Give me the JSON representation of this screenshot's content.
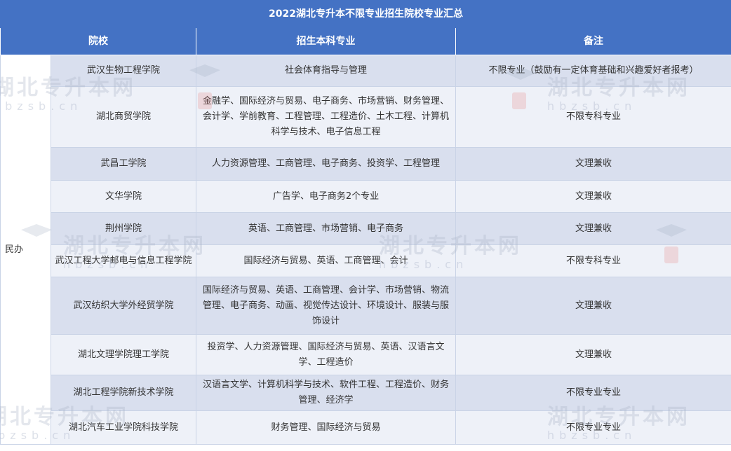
{
  "title": "2022湖北专升本不限专业招生院校专业汇总",
  "headers": {
    "school": "院校",
    "majors": "招生本科专业",
    "remarks": "备注"
  },
  "group_label": "民办",
  "rows": [
    {
      "school": "武汉生物工程学院",
      "majors": "社会体育指导与管理",
      "remarks": "不限专业（鼓励有一定体育基础和兴趣爱好者报考）"
    },
    {
      "school": "湖北商贸学院",
      "majors": "金融学、国际经济与贸易、电子商务、市场营销、财务管理、会计学、学前教育、工程管理、工程造价、土木工程、计算机科学与技术、电子信息工程",
      "remarks": "不限专科专业"
    },
    {
      "school": "武昌工学院",
      "majors": "人力资源管理、工商管理、电子商务、投资学、工程管理",
      "remarks": "文理兼收"
    },
    {
      "school": "文华学院",
      "majors": "广告学、电子商务2个专业",
      "remarks": "文理兼收"
    },
    {
      "school": "荆州学院",
      "majors": "英语、工商管理、市场营销、电子商务",
      "remarks": "文理兼收"
    },
    {
      "school": "武汉工程大学邮电与信息工程学院",
      "majors": "国际经济与贸易、英语、工商管理、会计",
      "remarks": "不限专科专业"
    },
    {
      "school": "武汉纺织大学外经贸学院",
      "majors": "国际经济与贸易、英语、工商管理、会计学、市场营销、物流管理、电子商务、动画、视觉传达设计、环境设计、服装与服饰设计",
      "remarks": "文理兼收"
    },
    {
      "school": "湖北文理学院理工学院",
      "majors": "投资学、人力资源管理、国际经济与贸易、英语、汉语言文学、工程造价",
      "remarks": "文理兼收"
    },
    {
      "school": "湖北工程学院新技术学院",
      "majors": "汉语言文学、计算机科学与技术、软件工程、工程造价、财务管理、经济学",
      "remarks": "不限专业专业"
    },
    {
      "school": "湖北汽车工业学院科技学院",
      "majors": "财务管理、国际经济与贸易",
      "remarks": "不限专业专业"
    }
  ],
  "watermark": {
    "cn": "湖北专升本网",
    "en": "hbzsb.cn"
  }
}
